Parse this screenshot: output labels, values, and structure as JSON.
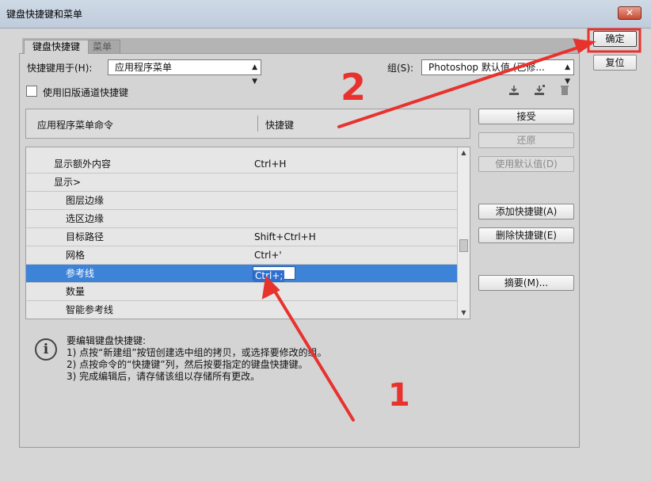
{
  "window": {
    "title": "键盘快捷键和菜单",
    "close_label": "✕"
  },
  "tabs": [
    {
      "label": "键盘快捷键"
    },
    {
      "label": "菜单"
    }
  ],
  "shortcuts_for": {
    "label": "快捷键用于(H):",
    "value": "应用程序菜单"
  },
  "group": {
    "label": "组(S):",
    "value": "Photoshop 默认值 (已修..."
  },
  "legacy_channel": {
    "label": "使用旧版通道快捷键",
    "checked": false
  },
  "toolbar_icons": [
    "save-set-icon",
    "new-set-icon",
    "delete-set-icon"
  ],
  "table": {
    "col_command": "应用程序菜单命令",
    "col_shortcut": "快捷键",
    "rows": [
      {
        "command": "显示额外内容",
        "shortcut": "Ctrl+H",
        "indent": 1
      },
      {
        "command": "显示>",
        "shortcut": "",
        "indent": 1
      },
      {
        "command": "图层边缘",
        "shortcut": "",
        "indent": 2
      },
      {
        "command": "选区边缘",
        "shortcut": "",
        "indent": 2
      },
      {
        "command": "目标路径",
        "shortcut": "Shift+Ctrl+H",
        "indent": 2
      },
      {
        "command": "网格",
        "shortcut": "Ctrl+'",
        "indent": 2
      },
      {
        "command": "参考线",
        "shortcut": "Ctrl+;",
        "indent": 2,
        "selected": true
      },
      {
        "command": "数量",
        "shortcut": "",
        "indent": 2
      },
      {
        "command": "智能参考线",
        "shortcut": "",
        "indent": 2
      }
    ]
  },
  "side_buttons": {
    "accept": "接受",
    "undo": "还原",
    "use_default": "使用默认值(D)",
    "add_shortcut": "添加快捷键(A)",
    "delete_shortcut": "删除快捷键(E)",
    "summarize": "摘要(M)..."
  },
  "dialog_buttons": {
    "ok": "确定",
    "reset": "复位"
  },
  "info": {
    "heading": "要编辑键盘快捷键:",
    "steps": [
      "1) 点按“新建组”按钮创建选中组的拷贝，或选择要修改的组。",
      "2) 点按命令的“快捷键”列，然后按要指定的键盘快捷键。",
      "3) 完成编辑后，请存储该组以存储所有更改。"
    ]
  },
  "annotations": {
    "marker_1": "1",
    "marker_2": "2",
    "color": "#e8322d"
  }
}
